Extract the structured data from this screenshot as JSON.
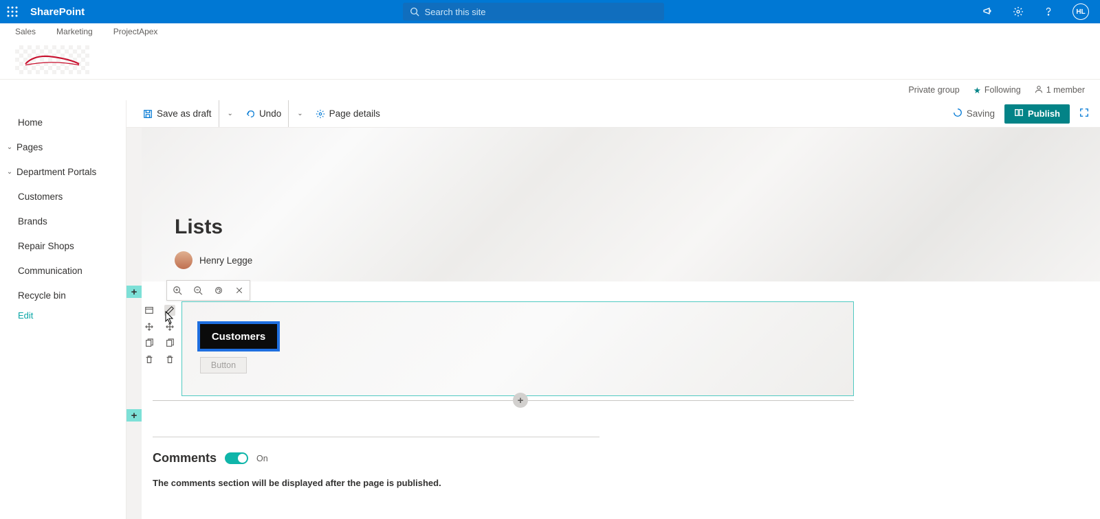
{
  "suite": {
    "brand": "SharePoint",
    "search_placeholder": "Search this site",
    "user_initials": "HL"
  },
  "hub_nav": [
    "Sales",
    "Marketing",
    "ProjectApex"
  ],
  "status": {
    "group_privacy": "Private group",
    "follow_label": "Following",
    "member_count": "1 member"
  },
  "left_nav": {
    "home": "Home",
    "pages": "Pages",
    "dept": "Department Portals",
    "items": [
      "Customers",
      "Brands",
      "Repair Shops",
      "Communication",
      "Recycle bin"
    ],
    "edit": "Edit"
  },
  "cmd": {
    "save_draft": "Save as draft",
    "undo": "Undo",
    "page_details": "Page details",
    "saving": "Saving",
    "publish": "Publish"
  },
  "hero": {
    "title": "Lists",
    "author": "Henry Legge"
  },
  "webpart": {
    "tooltip": "Edit web part",
    "button_label": "Customers",
    "placeholder": "Button"
  },
  "comments": {
    "heading": "Comments",
    "toggle_state": "On",
    "note": "The comments section will be displayed after the page is published."
  }
}
